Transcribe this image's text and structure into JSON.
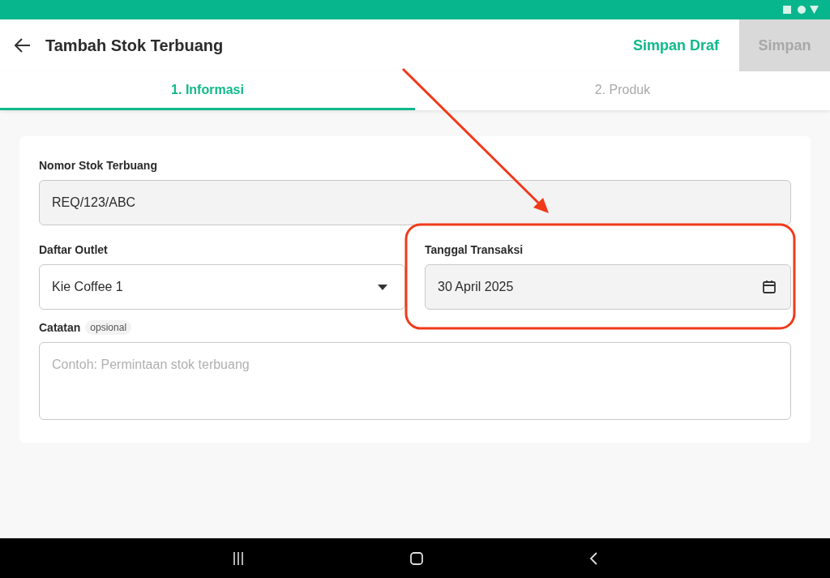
{
  "title": "Tambah Stok Terbuang",
  "actions": [
    {
      "label": "Simpan Draf",
      "kind": "text",
      "disabled": false
    },
    {
      "label": "Simpan",
      "kind": "filled",
      "disabled": true
    }
  ],
  "tabs": [
    {
      "label": "1. Informasi",
      "selected": true
    },
    {
      "label": "2. Produk",
      "selected": false
    }
  ],
  "form": {
    "fields": [
      {
        "label": "Nomor Stok Terbuang",
        "value": "REQ/123/ABC",
        "kind": "text",
        "disabled": true
      },
      {
        "label": "Daftar Outlet",
        "value": "Kie Coffee 1",
        "kind": "select",
        "disabled": false
      },
      {
        "label": "Tanggal Transaksi",
        "value": "30 April 2025",
        "kind": "date",
        "disabled": true
      },
      {
        "label": "Catatan",
        "badge": "opsional",
        "placeholder": "Contoh: Permintaan stok terbuang",
        "kind": "textarea",
        "disabled": false
      }
    ]
  }
}
